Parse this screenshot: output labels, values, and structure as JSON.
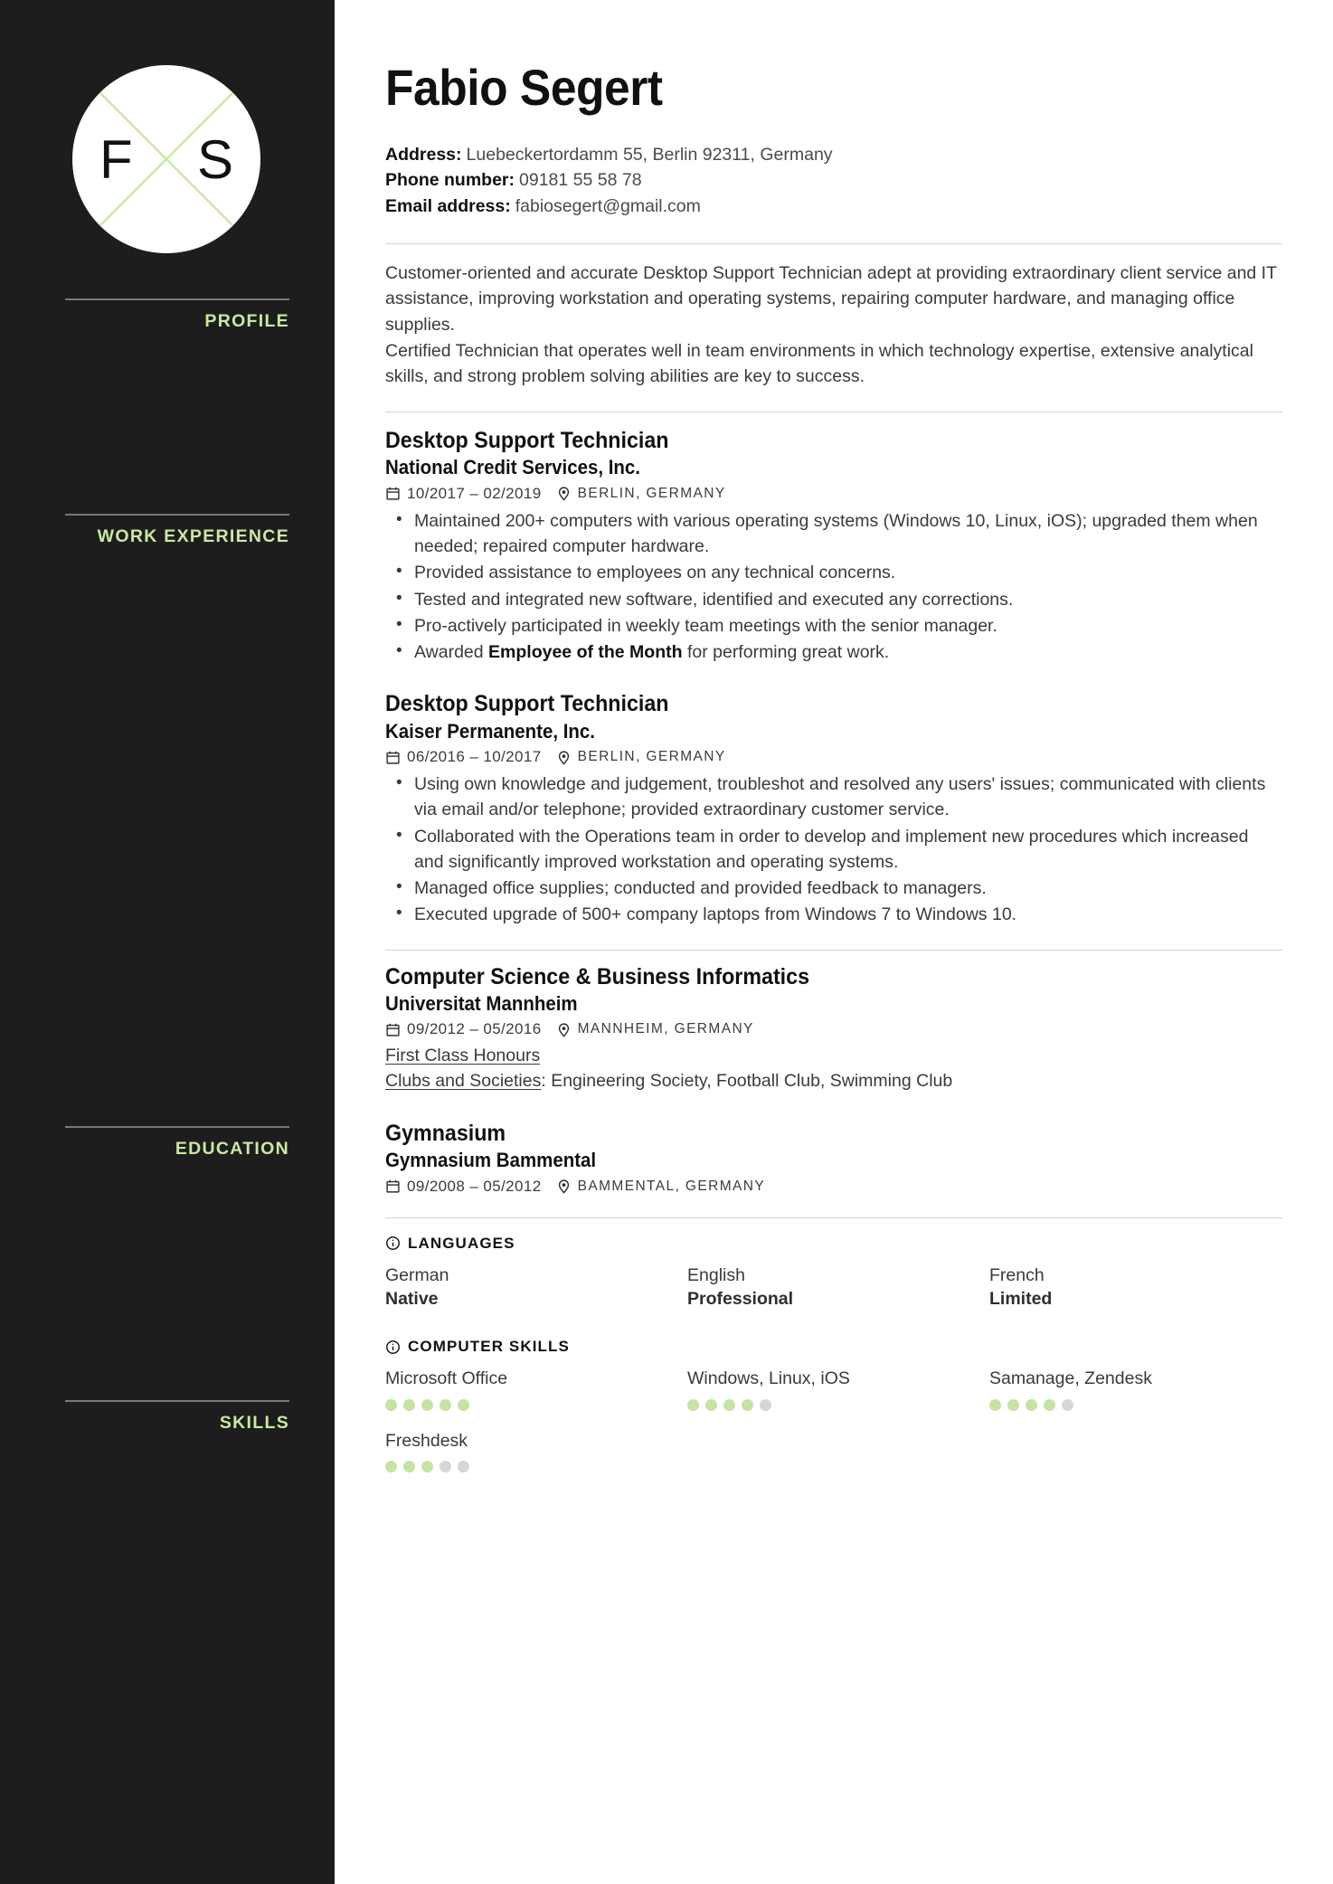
{
  "theme": {
    "sidebar_bg": "#1d1d1d",
    "accent_green": "#cbe8a5",
    "dot_on": "#c5e3a2",
    "dot_off": "#d6d6d6",
    "text": "#3a3a3a"
  },
  "logo": {
    "initial_left": "F",
    "initial_right": "S"
  },
  "header": {
    "name": "Fabio Segert",
    "contacts": [
      {
        "label": "Address:",
        "value": "Luebeckertordamm 55, Berlin 92311, Germany"
      },
      {
        "label": "Phone number:",
        "value": "09181 55 58 78"
      },
      {
        "label": "Email address:",
        "value": "fabiosegert@gmail.com"
      }
    ]
  },
  "sidebar": {
    "sections": [
      {
        "label": "PROFILE"
      },
      {
        "label": "WORK EXPERIENCE"
      },
      {
        "label": "EDUCATION"
      },
      {
        "label": "SKILLS"
      }
    ]
  },
  "profile": {
    "paragraph_1": "Customer-oriented and accurate Desktop Support Technician adept at providing extraordinary client service and IT assistance, improving workstation and operating systems, repairing computer hardware, and managing office supplies.",
    "paragraph_2": "Certified Technician that operates well in team environments in which technology expertise, extensive analytical skills, and strong problem solving abilities are key to success."
  },
  "work": [
    {
      "title": "Desktop Support Technician",
      "org": "National Credit Services, Inc.",
      "dates": "10/2017 – 02/2019",
      "location": "BERLIN, GERMANY",
      "bullets": [
        {
          "pre": "Maintained 200+ computers with various operating systems (Windows 10, Linux, iOS); upgraded them when needed; repaired computer hardware.",
          "bold": "",
          "post": ""
        },
        {
          "pre": "Provided assistance to employees on any technical concerns.",
          "bold": "",
          "post": ""
        },
        {
          "pre": "Tested and integrated new software, identified and executed any corrections.",
          "bold": "",
          "post": ""
        },
        {
          "pre": "Pro-actively participated in weekly team meetings with the senior manager.",
          "bold": "",
          "post": ""
        },
        {
          "pre": "Awarded ",
          "bold": "Employee of the Month",
          "post": " for performing great work."
        }
      ]
    },
    {
      "title": "Desktop Support Technician",
      "org": "Kaiser Permanente, Inc.",
      "dates": "06/2016 – 10/2017",
      "location": "BERLIN, GERMANY",
      "bullets": [
        {
          "pre": "Using own knowledge and judgement, troubleshot and resolved any users' issues; communicated with clients via email and/or telephone; provided extraordinary customer service.",
          "bold": "",
          "post": ""
        },
        {
          "pre": "Collaborated with the Operations team in order to develop and implement new procedures which increased and significantly improved workstation and operating systems.",
          "bold": "",
          "post": ""
        },
        {
          "pre": "Managed office supplies; conducted and provided feedback to managers.",
          "bold": "",
          "post": ""
        },
        {
          "pre": "Executed upgrade of 500+ company laptops from Windows 7 to Windows 10.",
          "bold": "",
          "post": ""
        }
      ]
    }
  ],
  "education": [
    {
      "title": "Computer Science & Business Informatics",
      "org": "Universitat Mannheim",
      "dates": "09/2012 – 05/2016",
      "location": "MANNHEIM, GERMANY",
      "honours": "First Class Honours",
      "clubs_label": "Clubs and Societies",
      "clubs_value": ": Engineering Society, Football Club, Swimming Club"
    },
    {
      "title": "Gymnasium",
      "org": "Gymnasium Bammental",
      "dates": "09/2008 – 05/2012",
      "location": "BAMMENTAL, GERMANY",
      "honours": "",
      "clubs_label": "",
      "clubs_value": ""
    }
  ],
  "skills": {
    "languages": {
      "heading": "LANGUAGES",
      "items": [
        {
          "name": "German",
          "level": "Native"
        },
        {
          "name": "English",
          "level": "Professional"
        },
        {
          "name": "French",
          "level": "Limited"
        }
      ]
    },
    "computer": {
      "heading": "COMPUTER SKILLS",
      "items": [
        {
          "name": "Microsoft Office",
          "rating": 5,
          "max": 5
        },
        {
          "name": "Windows, Linux, iOS",
          "rating": 4,
          "max": 5
        },
        {
          "name": "Samanage, Zendesk",
          "rating": 4,
          "max": 5
        },
        {
          "name": "Freshdesk",
          "rating": 3,
          "max": 5
        }
      ]
    }
  }
}
